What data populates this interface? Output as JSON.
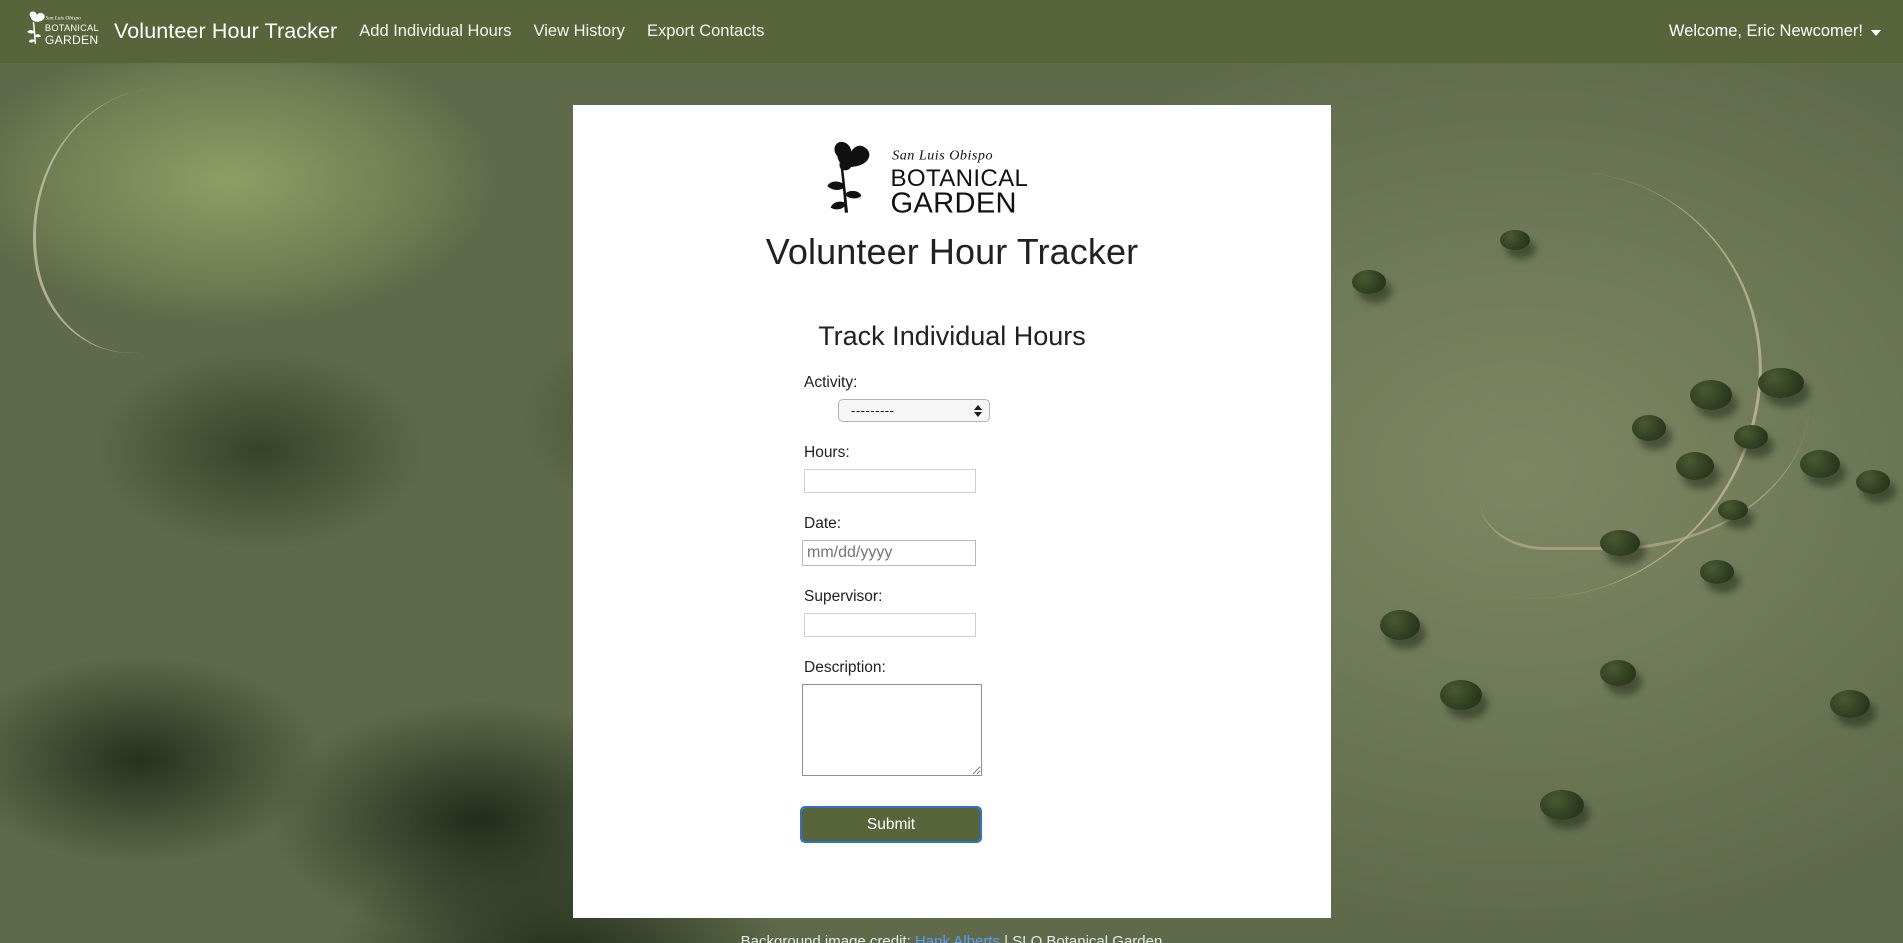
{
  "navbar": {
    "logo_alt": "San Luis Obispo Botanical Garden",
    "logo_line1": "San Luis Obispo",
    "logo_line2": "BOTANICAL",
    "logo_line3": "GARDEN",
    "brand_title": "Volunteer Hour Tracker",
    "links": [
      {
        "label": "Add Individual Hours"
      },
      {
        "label": "View History"
      },
      {
        "label": "Export Contacts"
      }
    ],
    "user_greeting": "Welcome, Eric Newcomer!",
    "caret_icon": "chevron-down-icon",
    "background_color": "#58643a"
  },
  "card": {
    "logo_line1": "San Luis Obispo",
    "logo_line2": "BOTANICAL",
    "logo_line3": "GARDEN",
    "heading": "Volunteer Hour Tracker",
    "subheading": "Track Individual Hours",
    "background_color": "#ffffff"
  },
  "form": {
    "fields": [
      {
        "label": "Activity:",
        "type": "select",
        "value": "---------",
        "placeholder": ""
      },
      {
        "label": "Hours:",
        "type": "number",
        "value": "",
        "placeholder": ""
      },
      {
        "label": "Date:",
        "type": "date",
        "value": "",
        "placeholder": "mm/dd/yyyy"
      },
      {
        "label": "Supervisor:",
        "type": "text",
        "value": "",
        "placeholder": ""
      },
      {
        "label": "Description:",
        "type": "textarea",
        "value": "",
        "placeholder": ""
      }
    ],
    "activity_options": [
      "---------"
    ],
    "date_placeholder": "mm/dd/yyyy",
    "submit_label": "Submit",
    "submit_color": "#58643a",
    "focus_ring_color": "#2f6fd0"
  },
  "footer": {
    "text_prefix": "Background image credit:",
    "link_label": "Hank Alberts",
    "suffix": "| SLO Botanical Garden"
  }
}
